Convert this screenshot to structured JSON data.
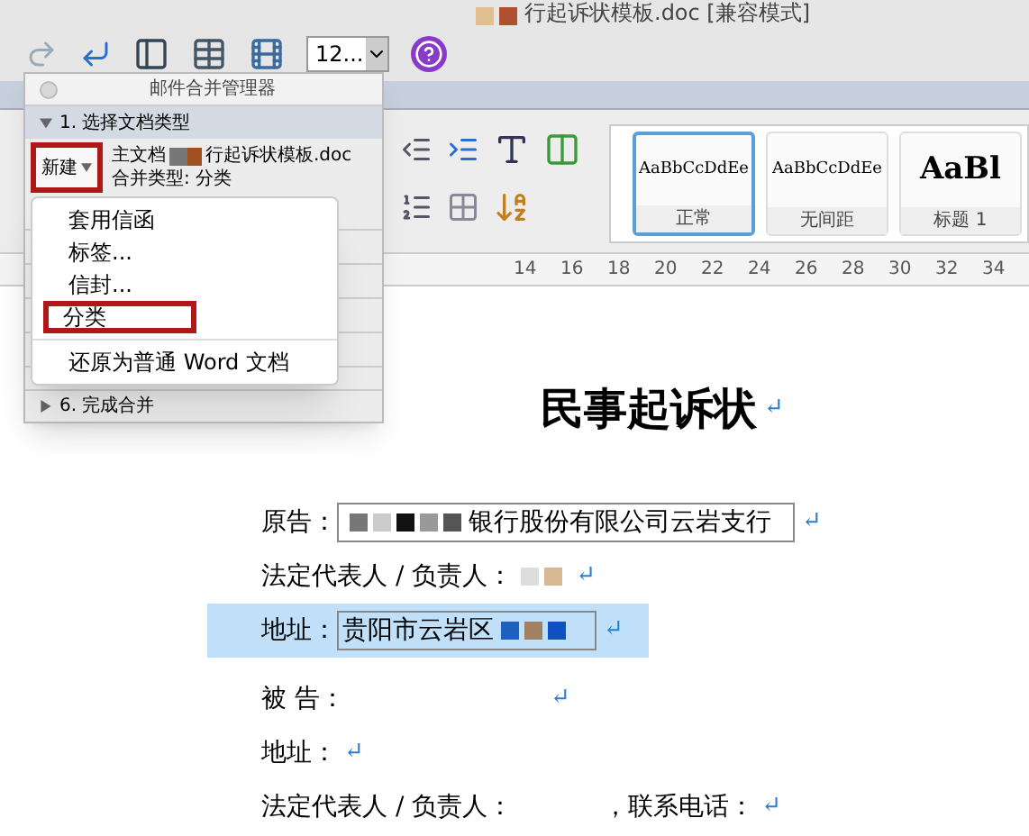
{
  "title_bar": {
    "title": "行起诉状模板.doc [兼容模式]"
  },
  "toolbar": {
    "zoom": "12..."
  },
  "ribbon": {
    "styles": [
      {
        "preview": "AaBbCcDdEe",
        "label": "正常",
        "selected": true
      },
      {
        "preview": "AaBbCcDdEe",
        "label": "无间距",
        "selected": false
      },
      {
        "preview": "AaBl",
        "label": "标题 1",
        "selected": false
      }
    ]
  },
  "ruler": [
    "14",
    "16",
    "18",
    "20",
    "22",
    "24",
    "26",
    "28",
    "30",
    "32",
    "34"
  ],
  "mail_merge": {
    "title": "邮件合并管理器",
    "step_open": {
      "label": "1. 选择文档类型",
      "expanded": true
    },
    "new_button": {
      "label": "新建",
      "highlighted": true
    },
    "main_doc_label": "主文档",
    "doc_name": "行起诉状模板.doc",
    "merge_type": "合并类型: 分类",
    "menu": [
      {
        "kind": "item",
        "label": "套用信函",
        "highlighted": false
      },
      {
        "kind": "item",
        "label": "标签...",
        "highlighted": false
      },
      {
        "kind": "item",
        "label": "信封...",
        "highlighted": false
      },
      {
        "kind": "item",
        "label": "分类",
        "highlighted": true
      },
      {
        "kind": "separator"
      },
      {
        "kind": "item",
        "label": "还原为普通 Word 文档",
        "highlighted": false
      }
    ],
    "step_last": {
      "label": "6. 完成合并",
      "expanded": false
    }
  },
  "document": {
    "title": "民事起诉状",
    "title_mark": "↵",
    "lines": [
      {
        "selected": false,
        "segments": [
          {
            "kind": "text",
            "text": "原告："
          },
          {
            "kind": "field",
            "parts": [
              {
                "kind": "mosaic"
              },
              {
                "kind": "text",
                "text": "银行股份有限公司云岩支行"
              }
            ]
          },
          {
            "kind": "mark",
            "text": "↵"
          }
        ]
      },
      {
        "selected": false,
        "segments": [
          {
            "kind": "text",
            "text": "法定代表人 / 负责人："
          },
          {
            "kind": "mosaic"
          },
          {
            "kind": "mark",
            "text": "↵"
          }
        ]
      },
      {
        "selected": true,
        "segments": [
          {
            "kind": "text",
            "text": "地址："
          },
          {
            "kind": "field",
            "parts": [
              {
                "kind": "text",
                "text": "贵阳市云岩区"
              },
              {
                "kind": "mosaic"
              }
            ]
          },
          {
            "kind": "mark",
            "text": "↵"
          }
        ]
      },
      {
        "selected": false,
        "segments": [
          {
            "kind": "text",
            "text": "被 告："
          },
          {
            "kind": "gap"
          },
          {
            "kind": "mark",
            "text": "↵"
          }
        ]
      },
      {
        "selected": false,
        "segments": [
          {
            "kind": "text",
            "text": "地址："
          },
          {
            "kind": "mark",
            "text": "↵"
          }
        ]
      },
      {
        "selected": false,
        "segments": [
          {
            "kind": "text",
            "text": "法定代表人 / 负责人："
          },
          {
            "kind": "gap"
          },
          {
            "kind": "text",
            "text": "，联系电话："
          },
          {
            "kind": "mark",
            "text": "↵"
          }
        ]
      }
    ]
  }
}
